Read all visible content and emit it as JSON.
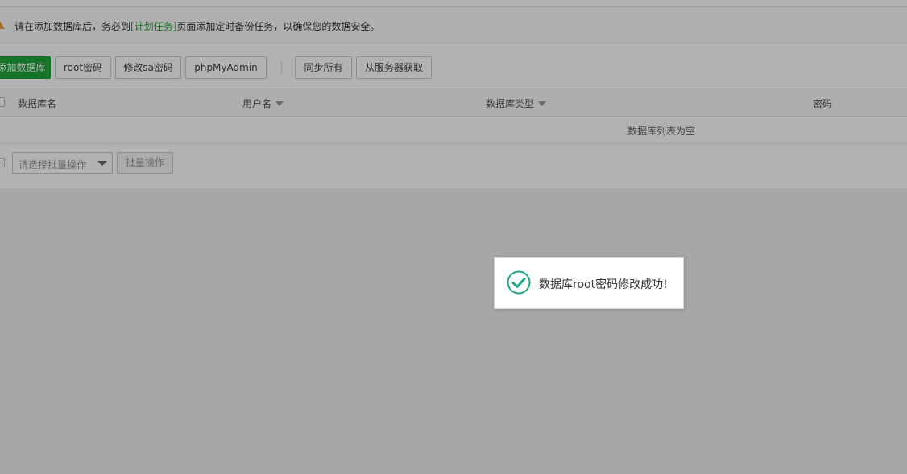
{
  "notice": {
    "prefix": "请在添加数据库后，务必到",
    "link": "[计划任务]",
    "suffix": "页面添加定时备份任务，以确保您的数据安全。"
  },
  "toolbar": {
    "add_db": "添加数据库",
    "root_pwd": "root密码",
    "change_sa": "修改sa密码",
    "phpmyadmin": "phpMyAdmin",
    "sync_all": "同步所有",
    "fetch_server": "从服务器获取"
  },
  "table": {
    "headers": {
      "db_name": "数据库名",
      "username": "用户名",
      "db_type": "数据库类型",
      "password": "密码"
    },
    "empty": "数据库列表为空"
  },
  "footer": {
    "batch_placeholder": "请选择批量操作",
    "batch_button": "批量操作"
  },
  "toast": {
    "message": "数据库root密码修改成功!"
  },
  "colors": {
    "accent": "#20a53a",
    "warning": "#e6a23c",
    "success_icon": "#20a58a"
  }
}
